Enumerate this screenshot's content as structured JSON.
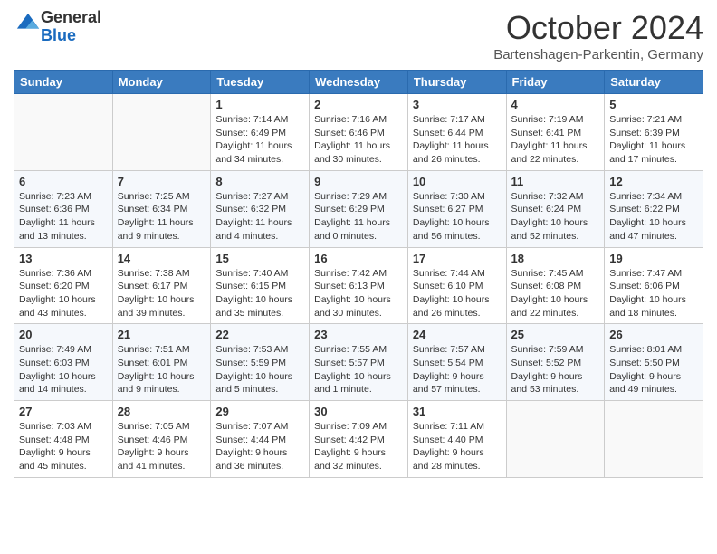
{
  "header": {
    "logo_general": "General",
    "logo_blue": "Blue",
    "month_title": "October 2024",
    "location": "Bartenshagen-Parkentin, Germany"
  },
  "weekdays": [
    "Sunday",
    "Monday",
    "Tuesday",
    "Wednesday",
    "Thursday",
    "Friday",
    "Saturday"
  ],
  "weeks": [
    [
      {
        "day": "",
        "sunrise": "",
        "sunset": "",
        "daylight": ""
      },
      {
        "day": "",
        "sunrise": "",
        "sunset": "",
        "daylight": ""
      },
      {
        "day": "1",
        "sunrise": "Sunrise: 7:14 AM",
        "sunset": "Sunset: 6:49 PM",
        "daylight": "Daylight: 11 hours and 34 minutes."
      },
      {
        "day": "2",
        "sunrise": "Sunrise: 7:16 AM",
        "sunset": "Sunset: 6:46 PM",
        "daylight": "Daylight: 11 hours and 30 minutes."
      },
      {
        "day": "3",
        "sunrise": "Sunrise: 7:17 AM",
        "sunset": "Sunset: 6:44 PM",
        "daylight": "Daylight: 11 hours and 26 minutes."
      },
      {
        "day": "4",
        "sunrise": "Sunrise: 7:19 AM",
        "sunset": "Sunset: 6:41 PM",
        "daylight": "Daylight: 11 hours and 22 minutes."
      },
      {
        "day": "5",
        "sunrise": "Sunrise: 7:21 AM",
        "sunset": "Sunset: 6:39 PM",
        "daylight": "Daylight: 11 hours and 17 minutes."
      }
    ],
    [
      {
        "day": "6",
        "sunrise": "Sunrise: 7:23 AM",
        "sunset": "Sunset: 6:36 PM",
        "daylight": "Daylight: 11 hours and 13 minutes."
      },
      {
        "day": "7",
        "sunrise": "Sunrise: 7:25 AM",
        "sunset": "Sunset: 6:34 PM",
        "daylight": "Daylight: 11 hours and 9 minutes."
      },
      {
        "day": "8",
        "sunrise": "Sunrise: 7:27 AM",
        "sunset": "Sunset: 6:32 PM",
        "daylight": "Daylight: 11 hours and 4 minutes."
      },
      {
        "day": "9",
        "sunrise": "Sunrise: 7:29 AM",
        "sunset": "Sunset: 6:29 PM",
        "daylight": "Daylight: 11 hours and 0 minutes."
      },
      {
        "day": "10",
        "sunrise": "Sunrise: 7:30 AM",
        "sunset": "Sunset: 6:27 PM",
        "daylight": "Daylight: 10 hours and 56 minutes."
      },
      {
        "day": "11",
        "sunrise": "Sunrise: 7:32 AM",
        "sunset": "Sunset: 6:24 PM",
        "daylight": "Daylight: 10 hours and 52 minutes."
      },
      {
        "day": "12",
        "sunrise": "Sunrise: 7:34 AM",
        "sunset": "Sunset: 6:22 PM",
        "daylight": "Daylight: 10 hours and 47 minutes."
      }
    ],
    [
      {
        "day": "13",
        "sunrise": "Sunrise: 7:36 AM",
        "sunset": "Sunset: 6:20 PM",
        "daylight": "Daylight: 10 hours and 43 minutes."
      },
      {
        "day": "14",
        "sunrise": "Sunrise: 7:38 AM",
        "sunset": "Sunset: 6:17 PM",
        "daylight": "Daylight: 10 hours and 39 minutes."
      },
      {
        "day": "15",
        "sunrise": "Sunrise: 7:40 AM",
        "sunset": "Sunset: 6:15 PM",
        "daylight": "Daylight: 10 hours and 35 minutes."
      },
      {
        "day": "16",
        "sunrise": "Sunrise: 7:42 AM",
        "sunset": "Sunset: 6:13 PM",
        "daylight": "Daylight: 10 hours and 30 minutes."
      },
      {
        "day": "17",
        "sunrise": "Sunrise: 7:44 AM",
        "sunset": "Sunset: 6:10 PM",
        "daylight": "Daylight: 10 hours and 26 minutes."
      },
      {
        "day": "18",
        "sunrise": "Sunrise: 7:45 AM",
        "sunset": "Sunset: 6:08 PM",
        "daylight": "Daylight: 10 hours and 22 minutes."
      },
      {
        "day": "19",
        "sunrise": "Sunrise: 7:47 AM",
        "sunset": "Sunset: 6:06 PM",
        "daylight": "Daylight: 10 hours and 18 minutes."
      }
    ],
    [
      {
        "day": "20",
        "sunrise": "Sunrise: 7:49 AM",
        "sunset": "Sunset: 6:03 PM",
        "daylight": "Daylight: 10 hours and 14 minutes."
      },
      {
        "day": "21",
        "sunrise": "Sunrise: 7:51 AM",
        "sunset": "Sunset: 6:01 PM",
        "daylight": "Daylight: 10 hours and 9 minutes."
      },
      {
        "day": "22",
        "sunrise": "Sunrise: 7:53 AM",
        "sunset": "Sunset: 5:59 PM",
        "daylight": "Daylight: 10 hours and 5 minutes."
      },
      {
        "day": "23",
        "sunrise": "Sunrise: 7:55 AM",
        "sunset": "Sunset: 5:57 PM",
        "daylight": "Daylight: 10 hours and 1 minute."
      },
      {
        "day": "24",
        "sunrise": "Sunrise: 7:57 AM",
        "sunset": "Sunset: 5:54 PM",
        "daylight": "Daylight: 9 hours and 57 minutes."
      },
      {
        "day": "25",
        "sunrise": "Sunrise: 7:59 AM",
        "sunset": "Sunset: 5:52 PM",
        "daylight": "Daylight: 9 hours and 53 minutes."
      },
      {
        "day": "26",
        "sunrise": "Sunrise: 8:01 AM",
        "sunset": "Sunset: 5:50 PM",
        "daylight": "Daylight: 9 hours and 49 minutes."
      }
    ],
    [
      {
        "day": "27",
        "sunrise": "Sunrise: 7:03 AM",
        "sunset": "Sunset: 4:48 PM",
        "daylight": "Daylight: 9 hours and 45 minutes."
      },
      {
        "day": "28",
        "sunrise": "Sunrise: 7:05 AM",
        "sunset": "Sunset: 4:46 PM",
        "daylight": "Daylight: 9 hours and 41 minutes."
      },
      {
        "day": "29",
        "sunrise": "Sunrise: 7:07 AM",
        "sunset": "Sunset: 4:44 PM",
        "daylight": "Daylight: 9 hours and 36 minutes."
      },
      {
        "day": "30",
        "sunrise": "Sunrise: 7:09 AM",
        "sunset": "Sunset: 4:42 PM",
        "daylight": "Daylight: 9 hours and 32 minutes."
      },
      {
        "day": "31",
        "sunrise": "Sunrise: 7:11 AM",
        "sunset": "Sunset: 4:40 PM",
        "daylight": "Daylight: 9 hours and 28 minutes."
      },
      {
        "day": "",
        "sunrise": "",
        "sunset": "",
        "daylight": ""
      },
      {
        "day": "",
        "sunrise": "",
        "sunset": "",
        "daylight": ""
      }
    ]
  ]
}
